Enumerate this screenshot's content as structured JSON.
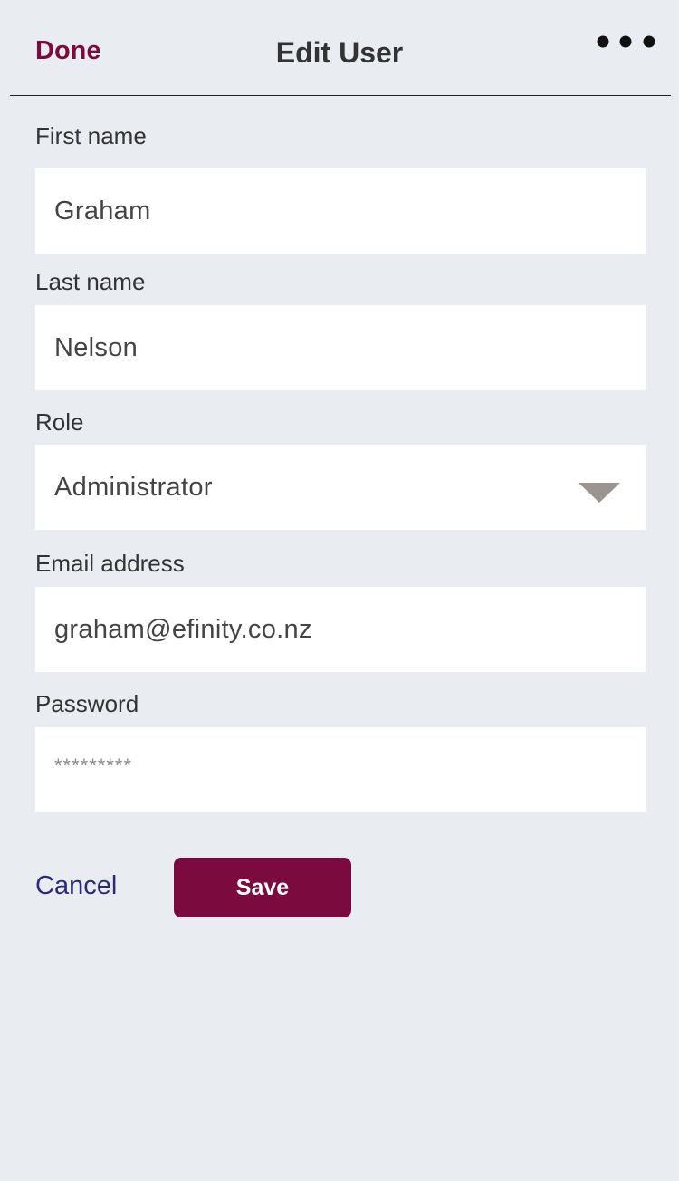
{
  "header": {
    "done_label": "Done",
    "title": "Edit User",
    "more_icon": "more-horizontal-icon"
  },
  "form": {
    "first_name": {
      "label": "First name",
      "value": "Graham"
    },
    "last_name": {
      "label": "Last name",
      "value": "Nelson"
    },
    "role": {
      "label": "Role",
      "value": "Administrator",
      "icon": "caret-down-icon"
    },
    "email": {
      "label": "Email address",
      "value": "graham@efinity.co.nz"
    },
    "password": {
      "label": "Password",
      "value": "*********"
    }
  },
  "actions": {
    "cancel_label": "Cancel",
    "save_label": "Save"
  },
  "colors": {
    "brand": "#7b0a3e",
    "link": "#2b2a7a",
    "background": "#e9ecf1"
  }
}
